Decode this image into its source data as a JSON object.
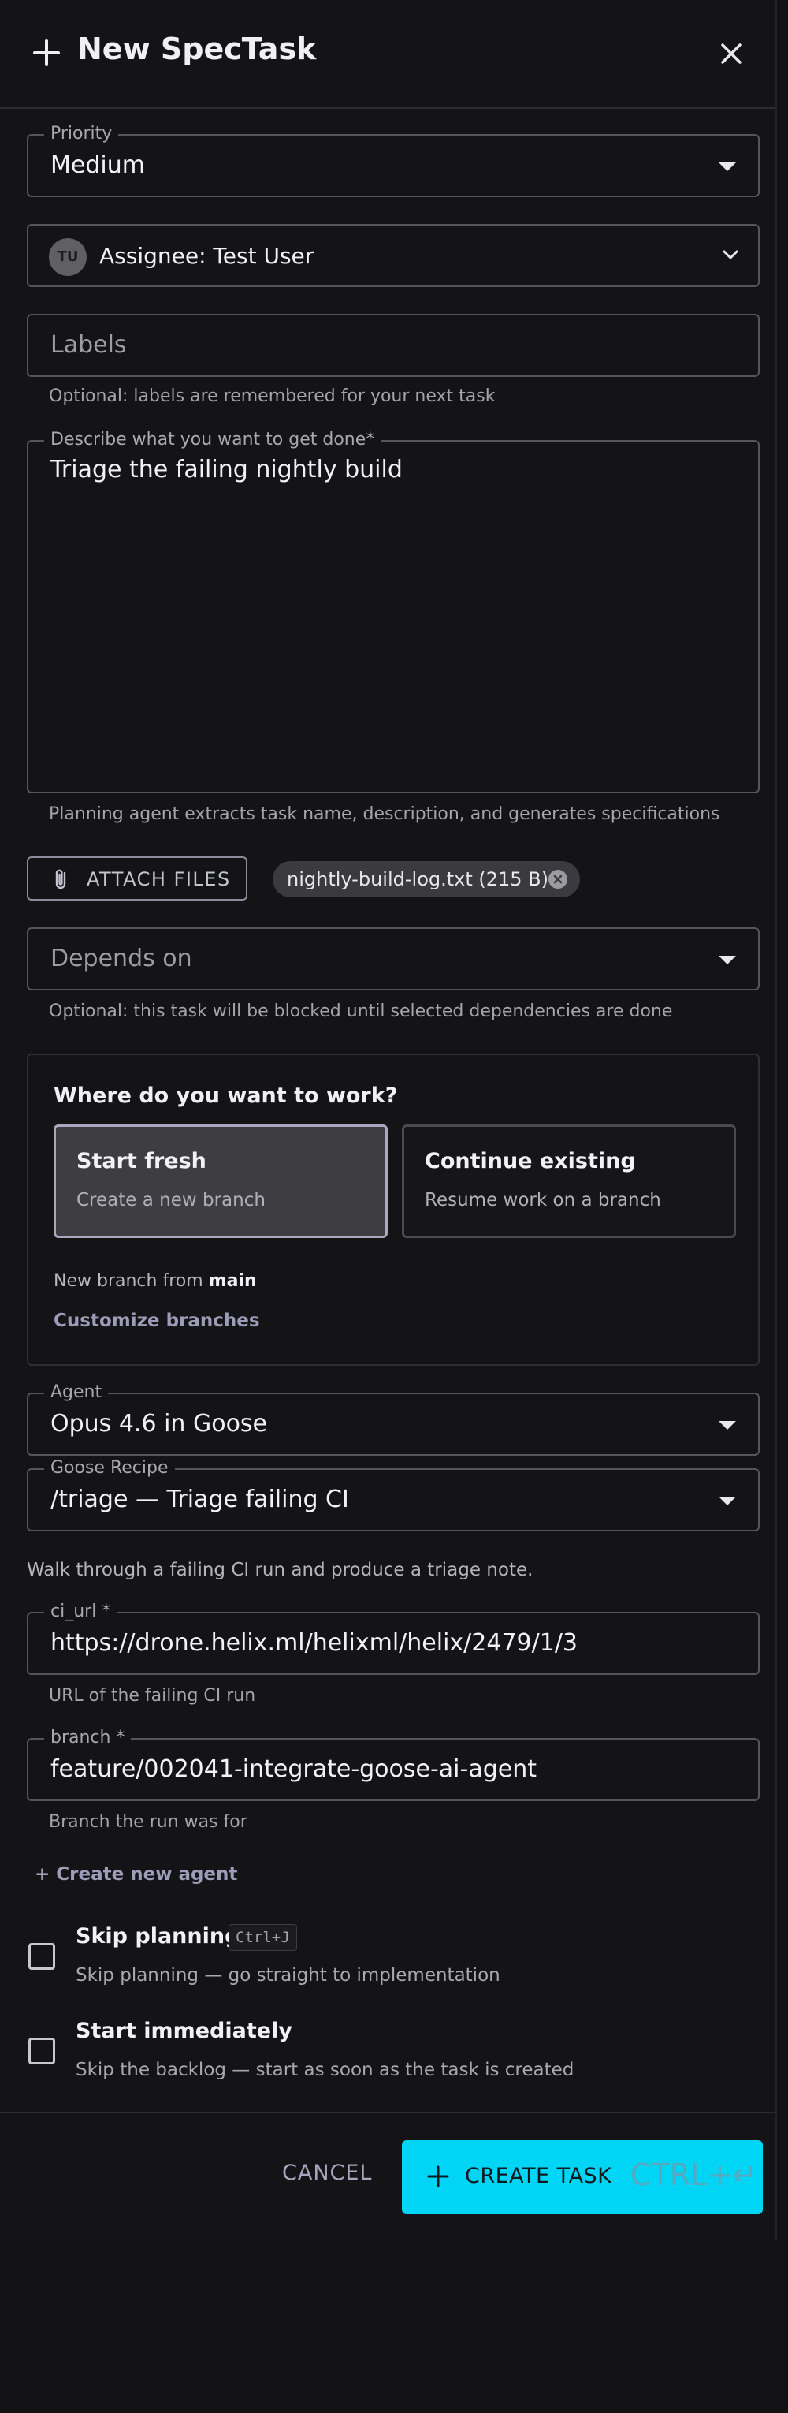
{
  "header": {
    "title": "New SpecTask"
  },
  "priority": {
    "label": "Priority",
    "value": "Medium"
  },
  "assignee": {
    "initials": "TU",
    "text": "Assignee: Test User"
  },
  "labels": {
    "placeholder": "Labels",
    "helper": "Optional: labels are remembered for your next task"
  },
  "description": {
    "label": "Describe what you want to get done",
    "required": "*",
    "value": "Triage the failing nightly build",
    "helper": "Planning agent extracts task name, description, and generates specifications"
  },
  "attachments": {
    "button_label": "ATTACH FILES",
    "files": [
      {
        "name": "nightly-build-log.txt (215 B)"
      }
    ]
  },
  "depends_on": {
    "placeholder": "Depends on",
    "helper": "Optional: this task will be blocked until selected dependencies are done"
  },
  "workspace": {
    "title": "Where do you want to work?",
    "options": [
      {
        "title": "Start fresh",
        "subtitle": "Create a new branch",
        "selected": true
      },
      {
        "title": "Continue existing",
        "subtitle": "Resume work on a branch",
        "selected": false
      }
    ],
    "branch_prefix": "New branch from",
    "base_branch": "main",
    "customize_label": "Customize branches"
  },
  "agent": {
    "label": "Agent",
    "value": "Opus 4.6 in Goose"
  },
  "recipe": {
    "label": "Goose Recipe",
    "value": "/triage — Triage failing CI",
    "description": "Walk through a failing CI run and produce a triage note."
  },
  "ci_url": {
    "label": "ci_url *",
    "value": "https://drone.helix.ml/helixml/helix/2479/1/3",
    "helper": "URL of the failing CI run"
  },
  "branch": {
    "label": "branch *",
    "value": "feature/002041-integrate-goose-ai-agent",
    "helper": "Branch the run was for"
  },
  "create_agent_label": "+ Create new agent",
  "skip_planning": {
    "title": "Skip planning",
    "shortcut": "Ctrl+J",
    "subtitle": "Skip planning — go straight to implementation",
    "checked": false
  },
  "start_immediately": {
    "title": "Start immediately",
    "subtitle": "Skip the backlog — start as soon as the task is created",
    "checked": false
  },
  "footer": {
    "cancel_label": "CANCEL",
    "create_label": "CREATE TASK",
    "create_shortcut": "CTRL+↵"
  },
  "colors": {
    "accent": "#00d5f5",
    "background": "#141416",
    "link": "#9d9dba"
  }
}
